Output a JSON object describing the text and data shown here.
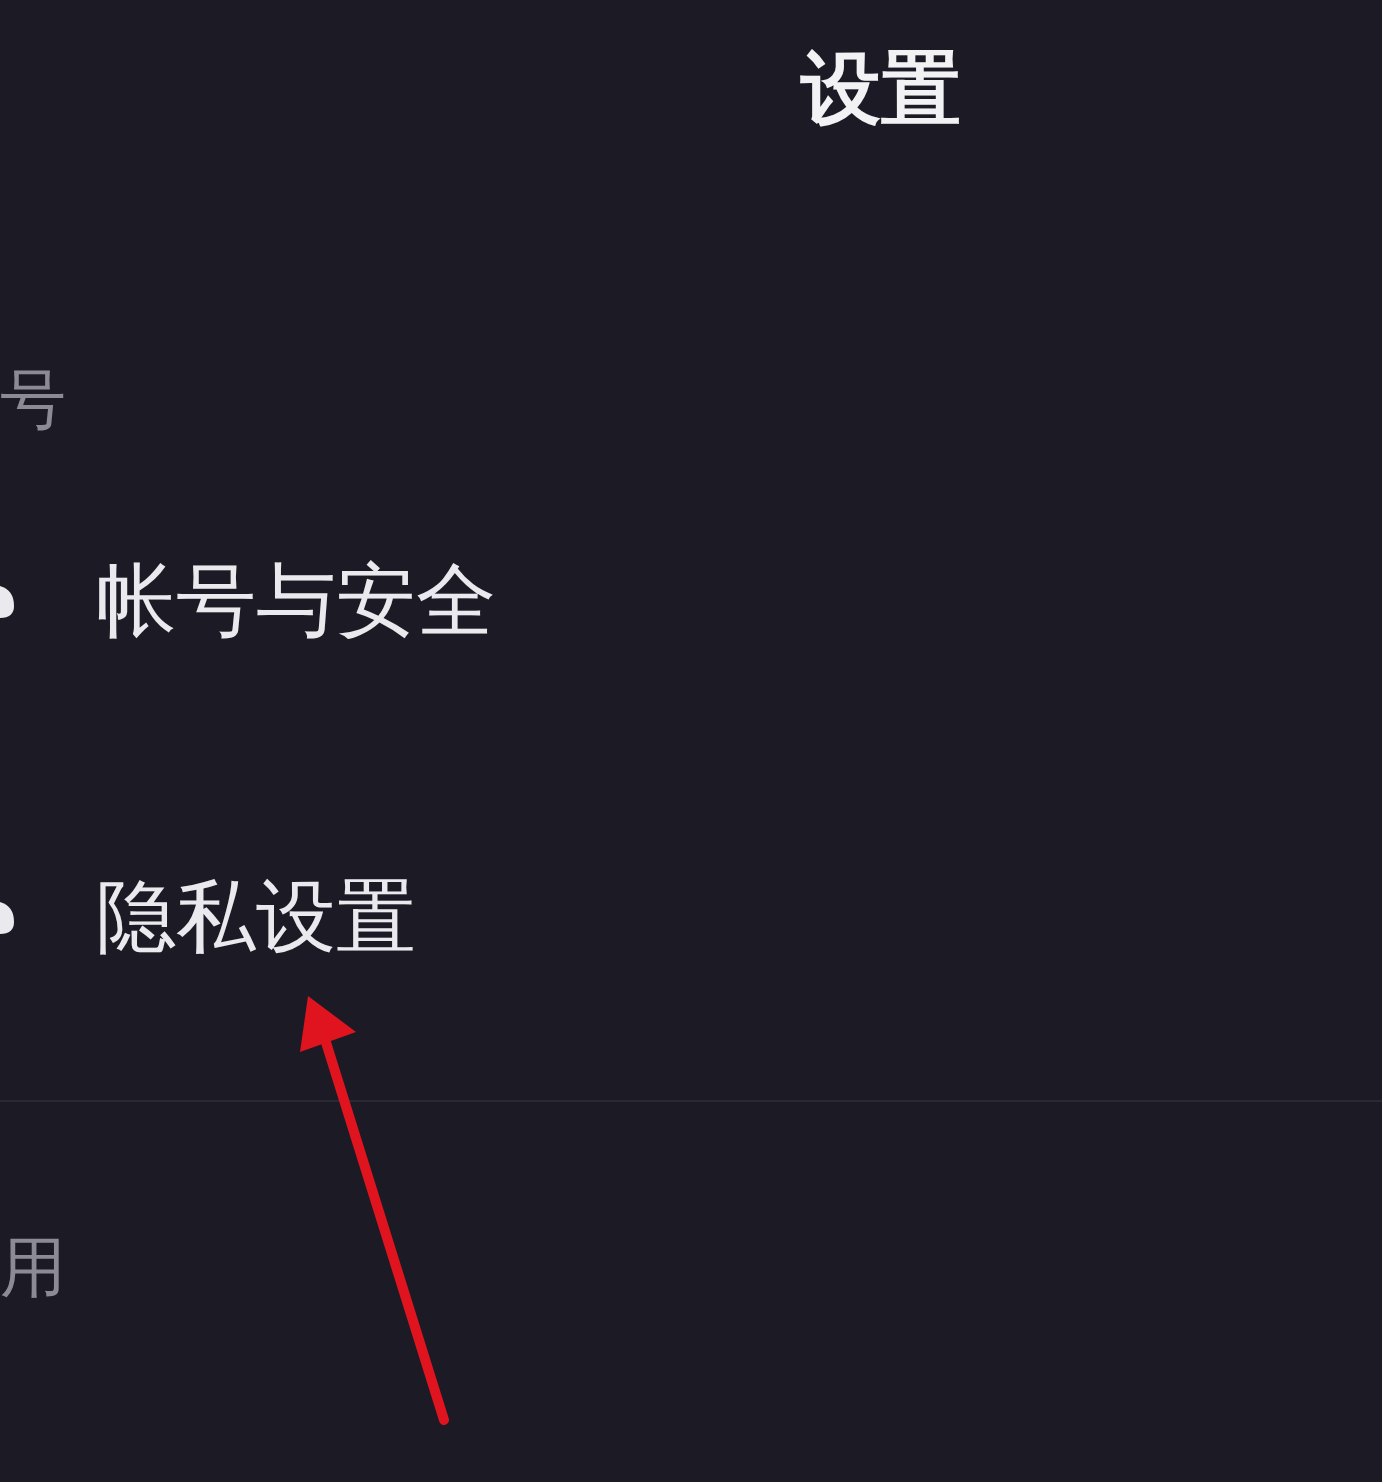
{
  "header": {
    "title": "设置"
  },
  "sections": [
    {
      "heading": "号",
      "items": [
        {
          "label": "帐号与安全"
        },
        {
          "label": "隐私设置"
        }
      ]
    },
    {
      "heading": "用"
    }
  ]
}
